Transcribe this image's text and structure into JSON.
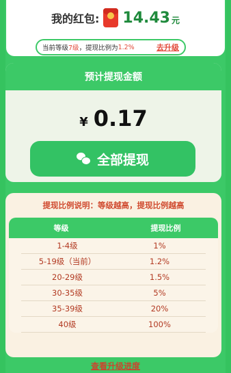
{
  "balance": {
    "label": "我的红包:",
    "amount": "14.43",
    "unit": "元"
  },
  "level": {
    "prefix": "当前等级",
    "value": "7级",
    "mid": "，提现比例为",
    "ratio": "1.2%",
    "upgrade_link": "去升级"
  },
  "withdraw": {
    "title": "预计提现金额",
    "currency": "¥",
    "amount": "0.17",
    "button_label": "全部提现"
  },
  "ratio_info": {
    "note": "提现比例说明：等级越高，提现比例越高",
    "headers": [
      "等级",
      "提现比例"
    ],
    "rows": [
      [
        "1-4级",
        "1%"
      ],
      [
        "5-19级（当前）",
        "1.2%"
      ],
      [
        "20-29级",
        "1.5%"
      ],
      [
        "30-35级",
        "5%"
      ],
      [
        "35-39级",
        "20%"
      ],
      [
        "40级",
        "100%"
      ]
    ]
  },
  "footer": {
    "progress_link": "查看升级进度"
  },
  "colors": {
    "green": "#3cc967",
    "red": "#e24a3a",
    "dark_green_text": "#1f8a3c"
  }
}
